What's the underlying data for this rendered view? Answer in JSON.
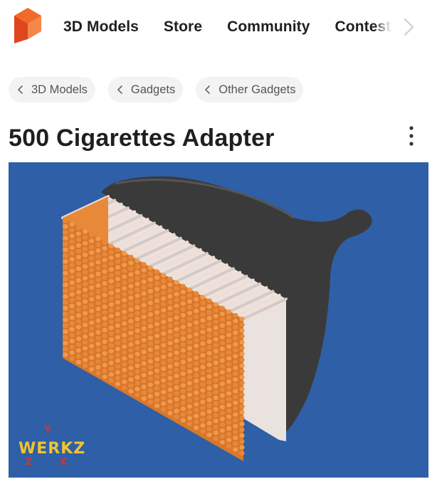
{
  "nav": {
    "links": [
      "3D Models",
      "Store",
      "Community",
      "Contest"
    ]
  },
  "breadcrumbs": [
    "3D Models",
    "Gadgets",
    "Other Gadgets"
  ],
  "page": {
    "title": "500 Cigarettes Adapter"
  },
  "model_image": {
    "watermark": "WERKZ",
    "colors": {
      "background": "#2f5fa6",
      "cigarette_filter": "#e8893a",
      "cigarette_paper": "#f2dcd4",
      "adapter_body": "#3a3a3a",
      "logo": "#f26a2a",
      "watermark": "#f0c430"
    }
  }
}
